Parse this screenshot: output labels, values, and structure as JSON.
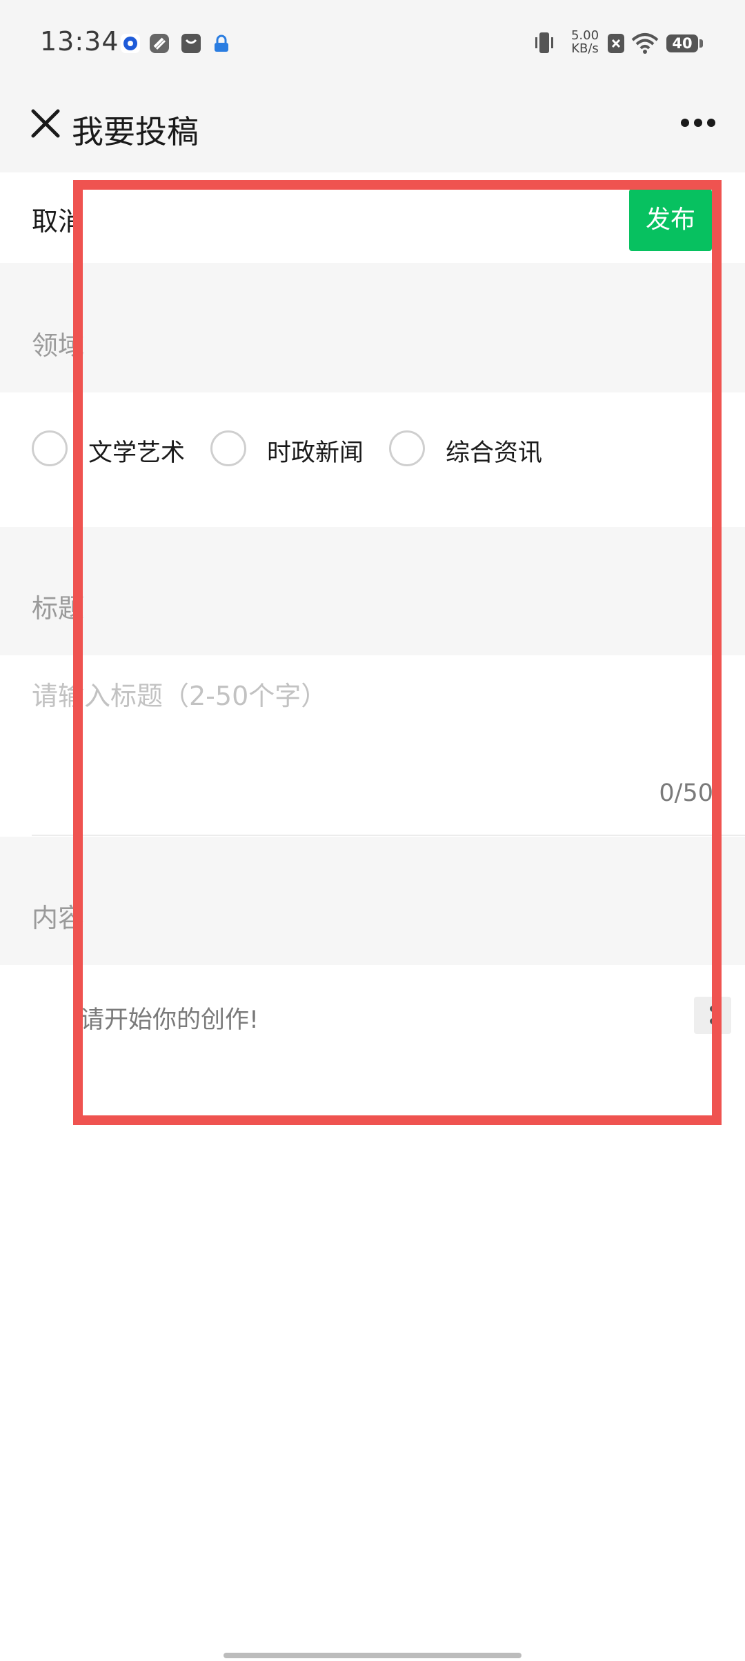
{
  "status_bar": {
    "time": "13:34",
    "network_speed_value": "5.00",
    "network_speed_unit": "KB/s",
    "battery": "40",
    "icons": [
      "app-notification-icon",
      "app-notification-icon",
      "app-notification-icon",
      "app-notification-icon",
      "vibrate-icon",
      "sim-off-icon",
      "wifi-icon",
      "battery-icon"
    ]
  },
  "header": {
    "title": "我要投稿",
    "close_icon": "close-icon",
    "more_icon": "more-icon"
  },
  "action_bar": {
    "cancel_label": "取消",
    "publish_label": "发布",
    "publish_color": "#07c160"
  },
  "sections": {
    "domain_label": "领域",
    "title_label": "标题",
    "content_label": "内容"
  },
  "domain_options": [
    {
      "label": "文学艺术",
      "selected": false
    },
    {
      "label": "时政新闻",
      "selected": false
    },
    {
      "label": "综合资讯",
      "selected": false
    }
  ],
  "title_input": {
    "placeholder": "请输入标题（2-50个字）",
    "value": "",
    "counter": "0/50"
  },
  "content_input": {
    "placeholder": "请开始你的创作!"
  },
  "highlight_color": "#ef5350"
}
